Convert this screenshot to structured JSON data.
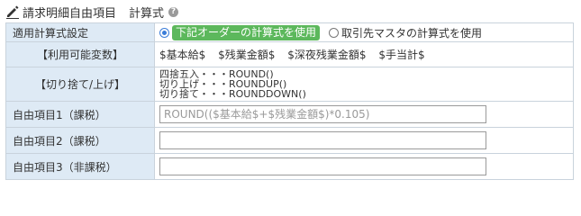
{
  "header": {
    "title": "請求明細自由項目",
    "subtitle": "計算式",
    "help_glyph": "?",
    "icons": [
      "pencil-icon",
      "help-icon"
    ]
  },
  "rows": {
    "formula_setting": {
      "label": "適用計算式設定",
      "options": [
        {
          "label": "下記オーダーの計算式を使用",
          "selected": true
        },
        {
          "label": "取引先マスタの計算式を使用",
          "selected": false
        }
      ]
    },
    "variables": {
      "label": "【利用可能変数】",
      "items": [
        "$基本給$",
        "$残業金額$",
        "$深夜残業金額$",
        "$手当計$"
      ]
    },
    "rounding": {
      "label": "【切り捨て/上げ】",
      "lines": [
        "四捨五入・・・ROUND()",
        "切り上げ・・・ROUNDUP()",
        "切り捨て・・・ROUNDDOWN()"
      ]
    },
    "free1": {
      "label": "自由項目1（課税）",
      "value": "",
      "placeholder": "ROUND(($基本給$+$残業金額$)*0.105)"
    },
    "free2": {
      "label": "自由項目2（課税）",
      "value": "",
      "placeholder": ""
    },
    "free3": {
      "label": "自由項目3（非課税）",
      "value": "",
      "placeholder": ""
    }
  },
  "colors": {
    "accent": "#5cb85c",
    "label_bg": "#deeaf5",
    "border": "#c9d3dc",
    "radio": "#3b7dd8"
  }
}
